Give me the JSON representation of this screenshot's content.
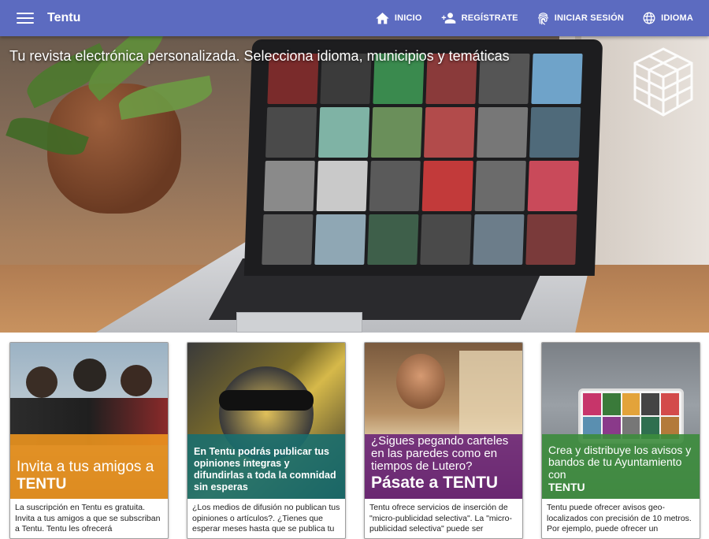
{
  "app": {
    "title": "Tentu"
  },
  "nav": {
    "items": [
      {
        "label": "INICIO",
        "icon": "home-icon"
      },
      {
        "label": "REGÍSTRATE",
        "icon": "add-user-icon"
      },
      {
        "label": "INICIAR SESIÓN",
        "icon": "fingerprint-icon"
      },
      {
        "label": "IDIOMA",
        "icon": "globe-icon"
      }
    ]
  },
  "hero": {
    "tagline": "Tu revista electrónica personalizada. Selecciona idioma, municipios y temáticas"
  },
  "cards": [
    {
      "overlay_line1": "Invita a tus amigos a",
      "overlay_line2": "TENTU",
      "overlay_color": "#f0961e",
      "text": "La suscripción en Tentu es gratuita. Invita a tus amigos a que se subscriban a Tentu. Tentu les ofrecerá"
    },
    {
      "overlay_line1": "En Tentu podrás publicar tus opiniones íntegras y difundirlas a toda la comnidad sin esperas",
      "overlay_line2": "",
      "overlay_color": "#196e6e",
      "text": "¿Los medios de difusión no publican tus opiniones o artículos?. ¿Tienes que esperar meses hasta que se publica tu"
    },
    {
      "overlay_line1": "¿Sigues pegando carteles en las paredes como en tiempos de Lutero?",
      "overlay_line2": "Pásate a TENTU",
      "overlay_color": "#6e2878",
      "text": "Tentu ofrece servicios de inserción de \"micro-publicidad selectiva\". La \"micro-publicidad selectiva\" puede ser"
    },
    {
      "overlay_line1": "Crea y distribuye los avisos y bandos de tu Ayuntamiento con",
      "overlay_line2": "TENTU",
      "overlay_color": "#3c8c3c",
      "text": "Tentu puede ofrecer avisos geo-localizados con precisión de 10 metros. Por ejemplo, puede ofrecer un"
    }
  ]
}
